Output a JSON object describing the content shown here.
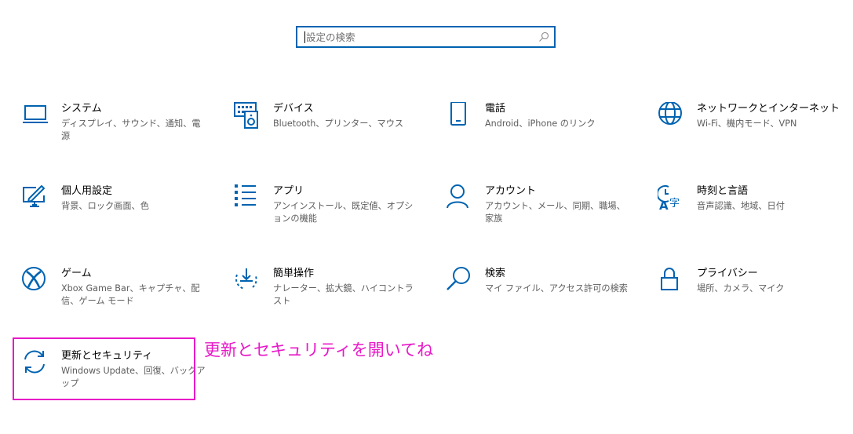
{
  "search": {
    "placeholder": "設定の検索",
    "icon": "search-icon"
  },
  "accent_color": "#0063b1",
  "annotation_color": "#e818c8",
  "tiles": [
    {
      "id": "system",
      "title": "システム",
      "desc": "ディスプレイ、サウンド、通知、電源",
      "icon": "laptop-icon"
    },
    {
      "id": "devices",
      "title": "デバイス",
      "desc": "Bluetooth、プリンター、マウス",
      "icon": "keyboard-speaker-icon"
    },
    {
      "id": "phone",
      "title": "電話",
      "desc": "Android、iPhone のリンク",
      "icon": "phone-icon"
    },
    {
      "id": "network",
      "title": "ネットワークとインターネット",
      "desc": "Wi-Fi、機内モード、VPN",
      "icon": "globe-icon"
    },
    {
      "id": "personalization",
      "title": "個人用設定",
      "desc": "背景、ロック画面、色",
      "icon": "paint-monitor-icon"
    },
    {
      "id": "apps",
      "title": "アプリ",
      "desc": "アンインストール、既定値、オプションの機能",
      "icon": "app-list-icon"
    },
    {
      "id": "accounts",
      "title": "アカウント",
      "desc": "アカウント、メール、同期、職場、家族",
      "icon": "person-icon"
    },
    {
      "id": "time",
      "title": "時刻と言語",
      "desc": "音声認識、地域、日付",
      "icon": "time-language-icon"
    },
    {
      "id": "gaming",
      "title": "ゲーム",
      "desc": "Xbox Game Bar、キャプチャ、配信、ゲーム モード",
      "icon": "xbox-icon"
    },
    {
      "id": "ease",
      "title": "簡単操作",
      "desc": "ナレーター、拡大鏡、ハイコントラスト",
      "icon": "ease-of-access-icon"
    },
    {
      "id": "search",
      "title": "検索",
      "desc": "マイ ファイル、アクセス許可の検索",
      "icon": "magnifier-icon"
    },
    {
      "id": "privacy",
      "title": "プライバシー",
      "desc": "場所、カメラ、マイク",
      "icon": "lock-icon"
    },
    {
      "id": "update",
      "title": "更新とセキュリティ",
      "desc": "Windows Update、回復、バックアップ",
      "icon": "sync-icon"
    }
  ],
  "annotation": {
    "text": "更新とセキュリティを開いてね"
  }
}
